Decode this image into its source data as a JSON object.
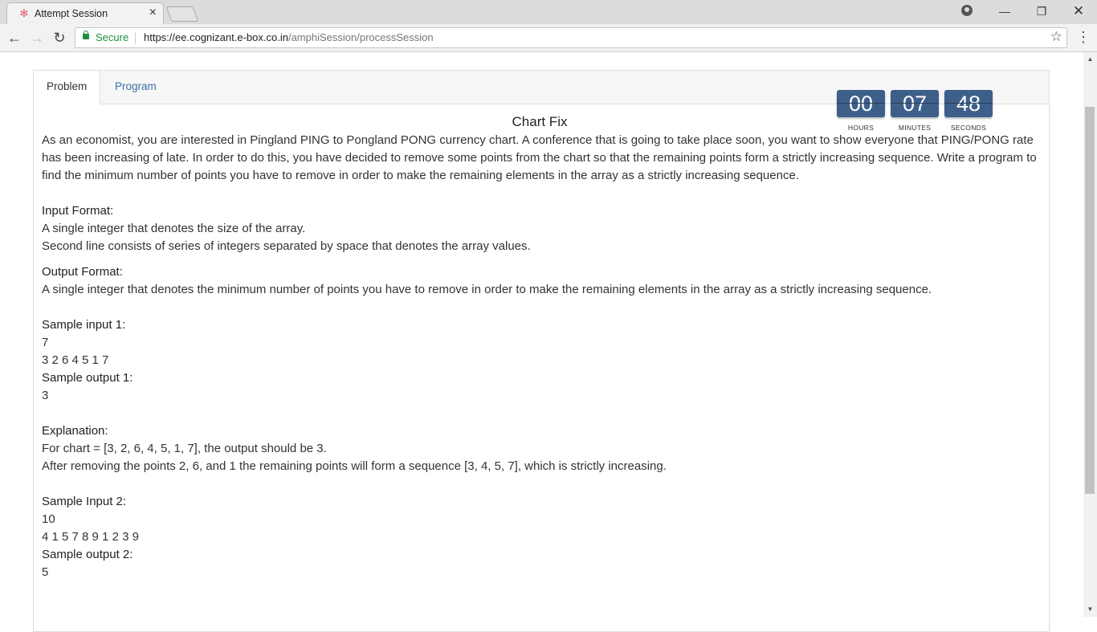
{
  "browser": {
    "tab_title": "Attempt Session",
    "secure_label": "Secure",
    "url_host": "https://ee.cognizant.e-box.co.in",
    "url_path": "/amphiSession/processSession"
  },
  "tabs": [
    {
      "label": "Problem",
      "active": true
    },
    {
      "label": "Program",
      "active": false
    }
  ],
  "timer": {
    "hours": "00",
    "minutes": "07",
    "seconds": "48",
    "hours_label": "HOURS",
    "minutes_label": "MINUTES",
    "seconds_label": "SECONDS",
    "color": "#3e5f8a"
  },
  "problem": {
    "title": "Chart Fix",
    "description": "As an economist, you are interested in Pingland PING to Pongland PONG currency chart. A conference that is going to take place soon, you want to show everyone that PING/PONG rate has been increasing of late. In order to do this, you have decided to remove some points from the chart so that the remaining points form a strictly increasing sequence. Write a program to find the minimum number of points you have to remove in order to make the remaining elements in the array as a strictly increasing sequence.",
    "input_format_heading": "Input Format:",
    "input_format_line1": "A single integer that denotes the size of the array.",
    "input_format_line2": "Second line consists of series of integers separated by space that denotes the array values.",
    "output_format_heading": "Output Format:",
    "output_format_line1": "A single integer that denotes the minimum number of points you have to remove in order to make the remaining elements in the array as a strictly increasing sequence.",
    "sample_input1_heading": "Sample input 1:",
    "sample_input1_line1": "7",
    "sample_input1_line2": "3 2 6 4 5 1 7",
    "sample_output1_heading": "Sample output 1:",
    "sample_output1_value": "3",
    "explanation_heading": "Explanation:",
    "explanation_line1": "For chart = [3, 2, 6, 4, 5, 1, 7], the output should be 3.",
    "explanation_line2": "After removing the points 2, 6, and 1 the remaining points will form a sequence [3, 4, 5, 7], which is strictly increasing.",
    "sample_input2_heading": "Sample Input 2:",
    "sample_input2_line1": "10",
    "sample_input2_line2": "4 1 5 7 8 9 1 2 3 9",
    "sample_output2_heading": "Sample output 2:",
    "sample_output2_value": "5"
  }
}
